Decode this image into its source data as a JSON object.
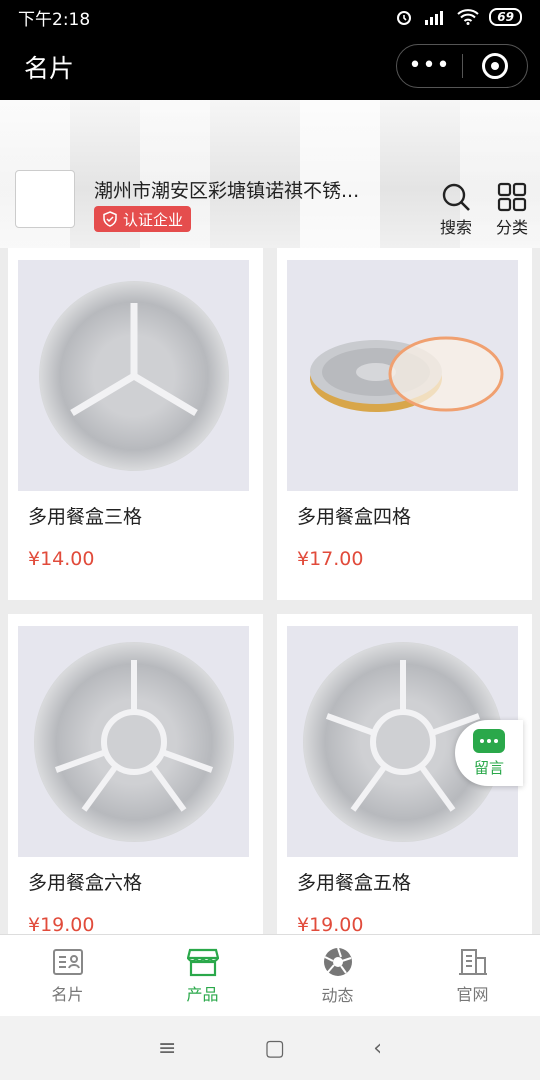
{
  "status": {
    "time": "下午2:18",
    "network": "HD",
    "battery": "69"
  },
  "nav": {
    "title": "名片",
    "more": "•••"
  },
  "header": {
    "company": "潮州市潮安区彩塘镇诺祺不锈...",
    "cert_label": "认证企业",
    "search_label": "搜索",
    "category_label": "分类"
  },
  "products": [
    {
      "name": "多用餐盒三格",
      "price": "¥14.00"
    },
    {
      "name": "多用餐盒四格",
      "price": "¥17.00"
    },
    {
      "name": "多用餐盒六格",
      "price": "¥19.00"
    },
    {
      "name": "多用餐盒五格",
      "price": "¥19.00"
    }
  ],
  "message_float": {
    "label": "留言"
  },
  "tabs": [
    {
      "label": "名片",
      "icon": "card-icon"
    },
    {
      "label": "产品",
      "icon": "store-icon"
    },
    {
      "label": "动态",
      "icon": "shutter-icon"
    },
    {
      "label": "官网",
      "icon": "building-icon"
    }
  ],
  "active_tab": "产品",
  "colors": {
    "accent": "#2aa84a",
    "price": "#e14b3b",
    "badge": "#e54d4d"
  },
  "system_nav": {
    "menu": "≡",
    "home": "▢",
    "back": "‹"
  }
}
